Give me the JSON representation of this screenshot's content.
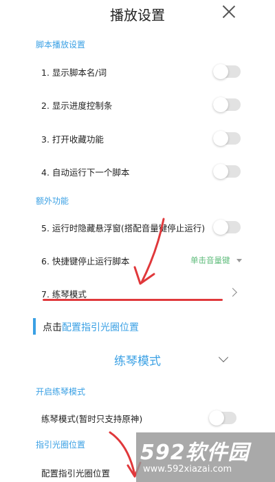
{
  "header": {
    "title": "播放设置"
  },
  "section_script": "脚本播放设置",
  "script_items": [
    {
      "label": "1. 显示脚本名/词",
      "toggle_on": false
    },
    {
      "label": "2. 显示进度控制条",
      "toggle_on": false
    },
    {
      "label": "3. 打开收藏功能",
      "toggle_on": false
    },
    {
      "label": "4. 自动运行下一个脚本",
      "toggle_on": false
    }
  ],
  "section_extra": "额外功能",
  "extra_items": [
    {
      "label": "5. 运行时隐藏悬浮窗(搭配音量键停止运行)",
      "toggle_on": false
    },
    {
      "label": "6. 快捷键停止运行脚本",
      "value": "单击音量键"
    },
    {
      "label": "7. 练琴模式"
    }
  ],
  "hint": {
    "prefix": "点击",
    "link": "配置指引光圈位置"
  },
  "practice": {
    "title": "练琴模式",
    "section_open": "开启练琴模式",
    "mode_label": "练琴模式(暂时只支持原神)",
    "mode_on": false,
    "section_ring": "指引光圈位置",
    "ring_label": "配置指引光圈位置"
  },
  "watermark": {
    "logo": "592软件园",
    "url": "www.592xiazai.com"
  },
  "colors": {
    "accent": "#3aa0e4",
    "green_value": "#5dbb7a",
    "annotation_red": "#e0383b"
  }
}
